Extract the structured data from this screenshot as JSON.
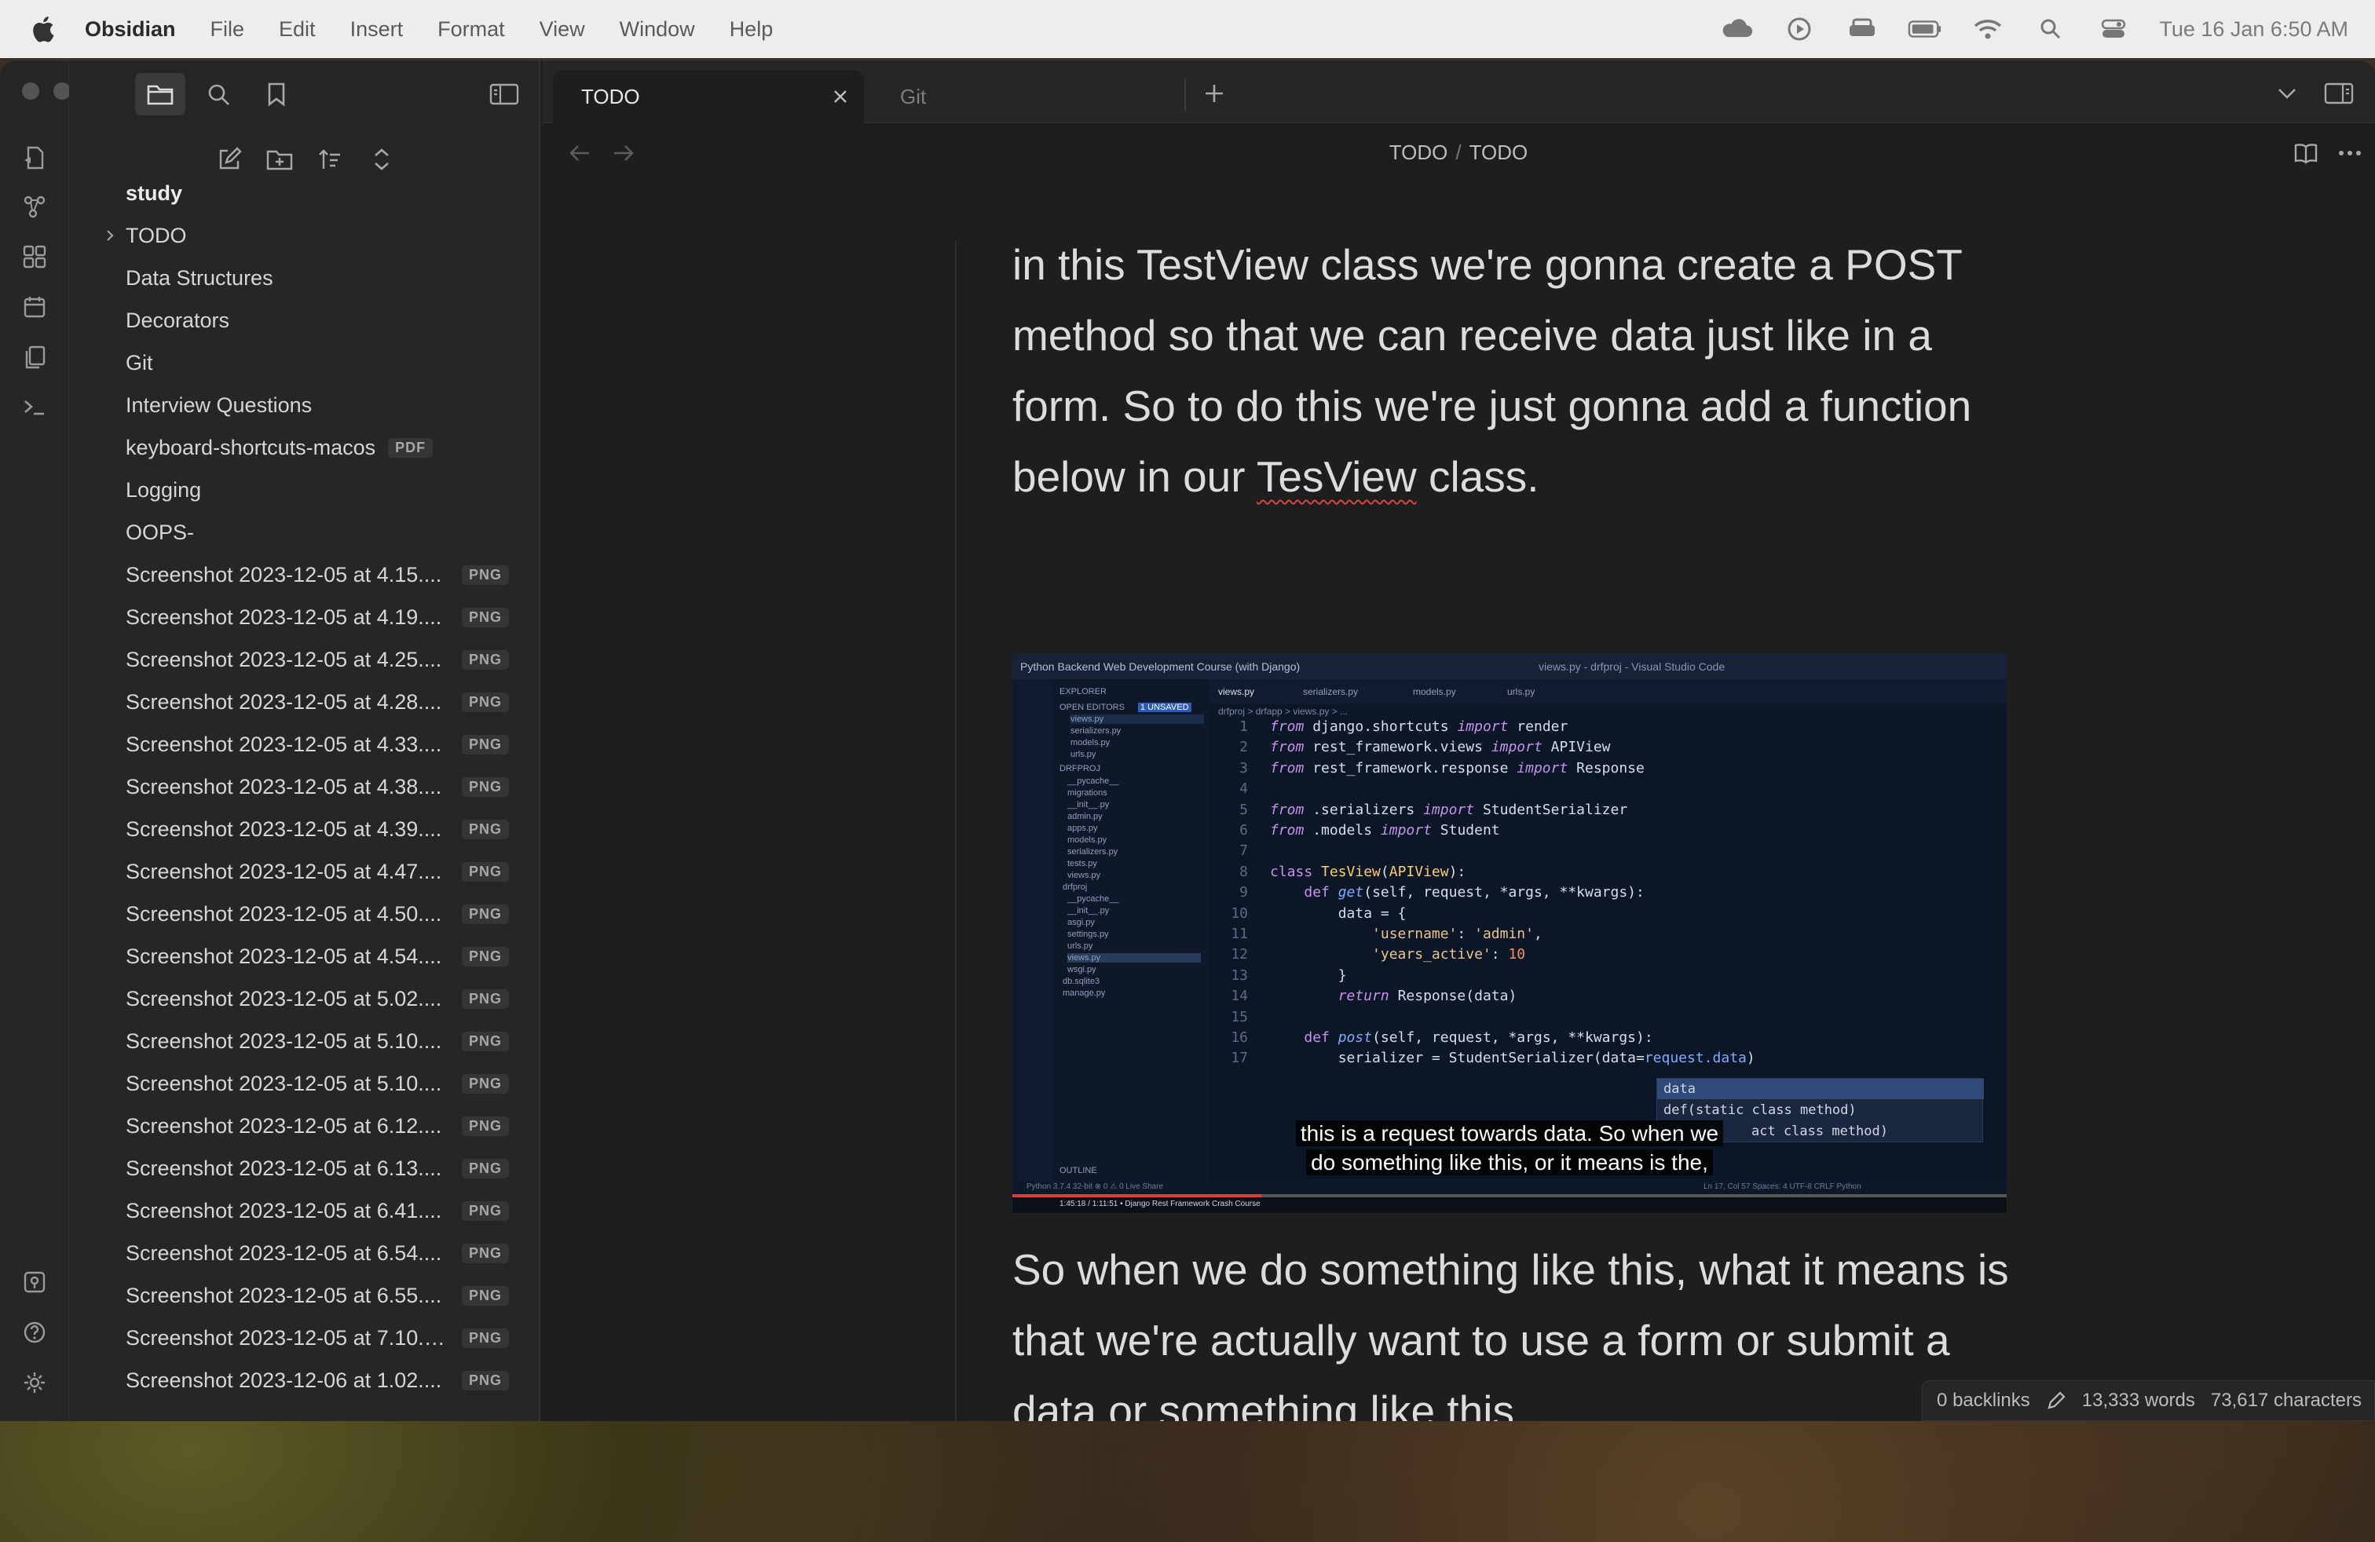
{
  "menubar": {
    "app_name": "Obsidian",
    "menus": [
      "File",
      "Edit",
      "Insert",
      "Format",
      "View",
      "Window",
      "Help"
    ],
    "clock": "Tue 16 Jan  6:50 AM"
  },
  "sidebar": {
    "items": [
      {
        "label": "study",
        "bold": true
      },
      {
        "label": "TODO",
        "collapsed": true
      },
      {
        "label": "Data Structures"
      },
      {
        "label": "Decorators"
      },
      {
        "label": "Git"
      },
      {
        "label": "Interview Questions"
      },
      {
        "label": "keyboard-shortcuts-macos",
        "badge": "PDF"
      },
      {
        "label": "Logging"
      },
      {
        "label": "OOPS-"
      },
      {
        "label": "Screenshot 2023-12-05 at 4.15....",
        "badge": "PNG"
      },
      {
        "label": "Screenshot 2023-12-05 at 4.19....",
        "badge": "PNG"
      },
      {
        "label": "Screenshot 2023-12-05 at 4.25....",
        "badge": "PNG"
      },
      {
        "label": "Screenshot 2023-12-05 at 4.28....",
        "badge": "PNG"
      },
      {
        "label": "Screenshot 2023-12-05 at 4.33....",
        "badge": "PNG"
      },
      {
        "label": "Screenshot 2023-12-05 at 4.38....",
        "badge": "PNG"
      },
      {
        "label": "Screenshot 2023-12-05 at 4.39....",
        "badge": "PNG"
      },
      {
        "label": "Screenshot 2023-12-05 at 4.47....",
        "badge": "PNG"
      },
      {
        "label": "Screenshot 2023-12-05 at 4.50....",
        "badge": "PNG"
      },
      {
        "label": "Screenshot 2023-12-05 at 4.54....",
        "badge": "PNG"
      },
      {
        "label": "Screenshot 2023-12-05 at 5.02....",
        "badge": "PNG"
      },
      {
        "label": "Screenshot 2023-12-05 at 5.10....",
        "badge": "PNG"
      },
      {
        "label": "Screenshot 2023-12-05 at 5.10....",
        "badge": "PNG"
      },
      {
        "label": "Screenshot 2023-12-05 at 6.12....",
        "badge": "PNG"
      },
      {
        "label": "Screenshot 2023-12-05 at 6.13....",
        "badge": "PNG"
      },
      {
        "label": "Screenshot 2023-12-05 at 6.41....",
        "badge": "PNG"
      },
      {
        "label": "Screenshot 2023-12-05 at 6.54....",
        "badge": "PNG"
      },
      {
        "label": "Screenshot 2023-12-05 at 6.55....",
        "badge": "PNG"
      },
      {
        "label": "Screenshot 2023-12-05 at 7.10.1...",
        "badge": "PNG"
      },
      {
        "label": "Screenshot 2023-12-06 at 1.02....",
        "badge": "PNG"
      }
    ]
  },
  "tabs": {
    "active": "TODO",
    "inactive": "Git"
  },
  "breadcrumb": {
    "folder": "TODO",
    "separator": "/",
    "file": "TODO"
  },
  "note": {
    "p1_before": "in this TestView class we're gonna create a POST method so that we can receive data just like in a form. So to do this we're just gonna add a function below in our ",
    "p1_misspelled": "TesView",
    "p1_after": " class.",
    "p2": "So when we do something like this, what it means is that we're actually want to use a form or submit a data or something like this."
  },
  "embedded_image": {
    "window_title": "Python Backend Web Development Course (with Django)",
    "vscode_title": "views.py - drfproj - Visual Studio Code",
    "tabs": [
      "views.py",
      "serializers.py",
      "models.py",
      "urls.py"
    ],
    "breadcrumb": "drfproj > drfapp > views.py > ...",
    "explorer": {
      "header": "EXPLORER",
      "open_editors": "OPEN EDITORS",
      "unsaved": "1 UNSAVED",
      "files": [
        "views.py",
        "serializers.py",
        "models.py",
        "urls.py",
        "DRFPROJ",
        "__pycache__",
        "migrations",
        "__init__.py",
        "admin.py",
        "apps.py",
        "models.py",
        "serializers.py",
        "tests.py",
        "views.py",
        "drfproj",
        "__pycache__",
        "__init__.py",
        "asgi.py",
        "settings.py",
        "urls.py",
        "views.py",
        "wsgi.py",
        "db.sqlite3",
        "manage.py"
      ],
      "outline": "OUTLINE"
    },
    "code_lines": [
      {
        "n": "1",
        "text": "from django.shortcuts import render"
      },
      {
        "n": "2",
        "text": "from rest_framework.views import APIView"
      },
      {
        "n": "3",
        "text": "from rest_framework.response import Response"
      },
      {
        "n": "4",
        "text": ""
      },
      {
        "n": "5",
        "text": "from .serializers import StudentSerializer"
      },
      {
        "n": "6",
        "text": "from .models import Student"
      },
      {
        "n": "7",
        "text": ""
      },
      {
        "n": "8",
        "text": "class TesView(APIView):"
      },
      {
        "n": "9",
        "text": "    def get(self, request, *args, **kwargs):"
      },
      {
        "n": "10",
        "text": "        data = {"
      },
      {
        "n": "11",
        "text": "            'username': 'admin',"
      },
      {
        "n": "12",
        "text": "            'years_active': 10"
      },
      {
        "n": "13",
        "text": "        }"
      },
      {
        "n": "14",
        "text": "        return Response(data)"
      },
      {
        "n": "15",
        "text": ""
      },
      {
        "n": "16",
        "text": "    def post(self, request, *args, **kwargs):"
      },
      {
        "n": "17",
        "text": "        serializer = StudentSerializer(data=request.data)"
      }
    ],
    "autocomplete": [
      "data",
      "def(static class method)",
      "act class method)"
    ],
    "subtitle_line1": "this is a request towards data. So when we",
    "subtitle_line2": "do something like this, or it means is the,",
    "status_left": "Python 3.7.4 32-bit   ⊗ 0 ⚠ 0   Live Share",
    "status_right": "Ln 17, Col 57   Spaces: 4   UTF-8   CRLF   Python",
    "player_time": "1:45:18 / 1:11:51 • Django Rest Framework Crash Course",
    "progress_fraction": 0.25
  },
  "footer": {
    "backlinks": "0 backlinks",
    "words": "13,333 words",
    "characters": "73,617 characters"
  },
  "colors": {
    "accent_red": "#d64545",
    "window_bg": "#1e1e1e",
    "sidebar_bg": "#262626"
  }
}
